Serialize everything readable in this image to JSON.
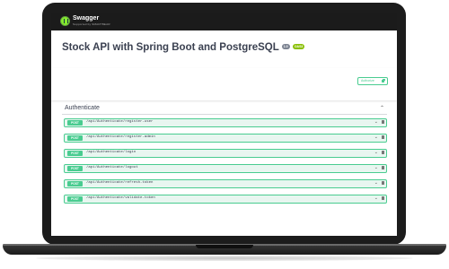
{
  "header": {
    "logo_text": "Swagger",
    "logo_subtext": "Supported by SMARTBEAR"
  },
  "info": {
    "title": "Stock API with Spring Boot and PostgreSQL",
    "version_badge": "1.0",
    "oas_badge": "OAS3"
  },
  "scheme": {
    "authorize_label": "Authorize"
  },
  "tag": {
    "name": "Authenticate"
  },
  "operations": [
    {
      "method": "POST",
      "path": "/api/Authenticate/register-user"
    },
    {
      "method": "POST",
      "path": "/api/Authenticate/register-admin"
    },
    {
      "method": "POST",
      "path": "/api/Authenticate/login"
    },
    {
      "method": "POST",
      "path": "/api/Authenticate/logout"
    },
    {
      "method": "POST",
      "path": "/api/Authenticate/refresh-token"
    },
    {
      "method": "POST",
      "path": "/api/Authenticate/validate-token"
    }
  ],
  "colors": {
    "post": "#49cc90",
    "topbar": "#1b1b1b",
    "logo": "#85ea2d"
  }
}
